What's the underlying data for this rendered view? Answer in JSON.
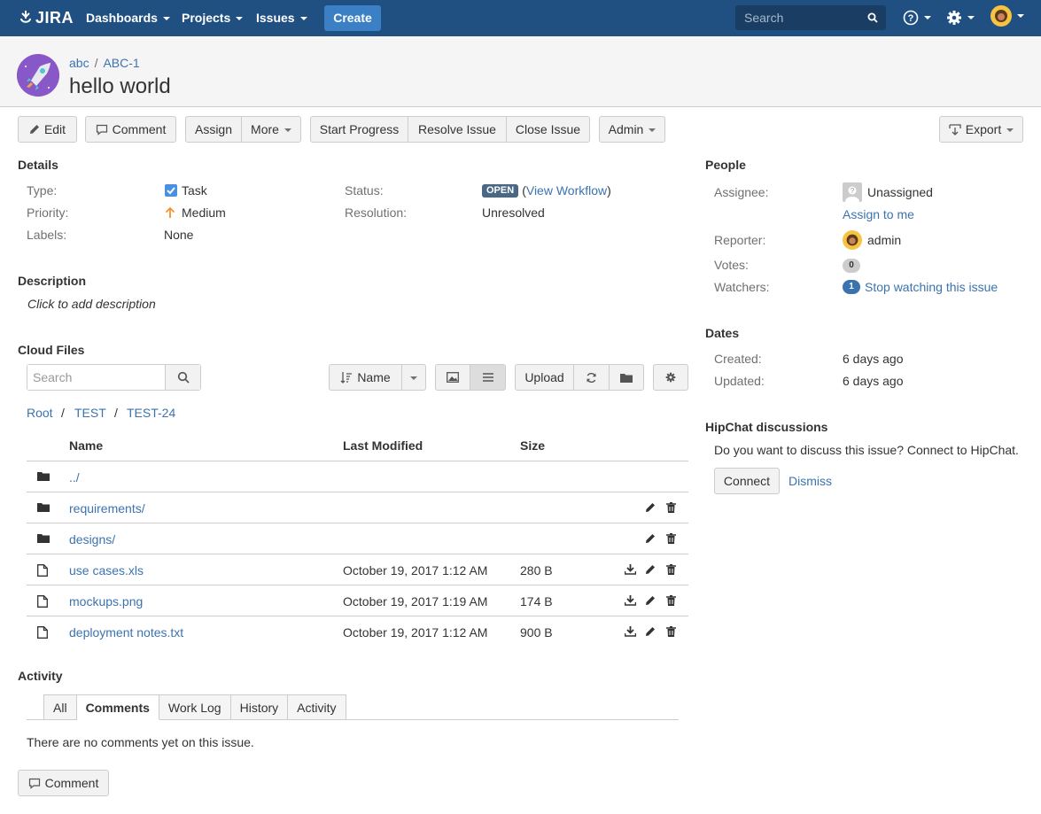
{
  "nav": {
    "logo": "JIRA",
    "dashboards": "Dashboards",
    "projects": "Projects",
    "issues": "Issues",
    "create": "Create",
    "search_placeholder": "Search"
  },
  "header": {
    "project": "abc",
    "issue_key": "ABC-1",
    "title": "hello world"
  },
  "toolbar": {
    "edit": "Edit",
    "comment": "Comment",
    "assign": "Assign",
    "more": "More",
    "start_progress": "Start Progress",
    "resolve": "Resolve Issue",
    "close": "Close Issue",
    "admin": "Admin",
    "export": "Export"
  },
  "details": {
    "heading": "Details",
    "type_label": "Type:",
    "type_value": "Task",
    "priority_label": "Priority:",
    "priority_value": "Medium",
    "labels_label": "Labels:",
    "labels_value": "None",
    "status_label": "Status:",
    "status_value": "OPEN",
    "view_workflow": "View Workflow",
    "resolution_label": "Resolution:",
    "resolution_value": "Unresolved"
  },
  "description": {
    "heading": "Description",
    "placeholder": "Click to add description"
  },
  "cloud_files": {
    "heading": "Cloud Files",
    "search_placeholder": "Search",
    "sort_label": "Name",
    "upload": "Upload",
    "breadcrumb": [
      "Root",
      "TEST",
      "TEST-24"
    ],
    "columns": {
      "name": "Name",
      "modified": "Last Modified",
      "size": "Size"
    },
    "rows": [
      {
        "type": "folder",
        "name": "../",
        "modified": "",
        "size": ""
      },
      {
        "type": "folder",
        "name": "requirements/",
        "modified": "",
        "size": ""
      },
      {
        "type": "folder",
        "name": "designs/",
        "modified": "",
        "size": ""
      },
      {
        "type": "file",
        "name": "use cases.xls",
        "modified": "October 19, 2017 1:12 AM",
        "size": "280 B"
      },
      {
        "type": "file",
        "name": "mockups.png",
        "modified": "October 19, 2017 1:19 AM",
        "size": "174 B"
      },
      {
        "type": "file",
        "name": "deployment notes.txt",
        "modified": "October 19, 2017 1:12 AM",
        "size": "900 B"
      }
    ]
  },
  "activity": {
    "heading": "Activity",
    "tabs": [
      "All",
      "Comments",
      "Work Log",
      "History",
      "Activity"
    ],
    "active_tab": "Comments",
    "empty_text": "There are no comments yet on this issue.",
    "comment_button": "Comment"
  },
  "people": {
    "heading": "People",
    "assignee_label": "Assignee:",
    "assignee_value": "Unassigned",
    "assign_to_me": "Assign to me",
    "reporter_label": "Reporter:",
    "reporter_value": "admin",
    "votes_label": "Votes:",
    "votes_count": "0",
    "watchers_label": "Watchers:",
    "watchers_count": "1",
    "stop_watching": "Stop watching this issue"
  },
  "dates": {
    "heading": "Dates",
    "created_label": "Created:",
    "created_value": "6 days ago",
    "updated_label": "Updated:",
    "updated_value": "6 days ago"
  },
  "hipchat": {
    "heading": "HipChat discussions",
    "text": "Do you want to discuss this issue? Connect to HipChat.",
    "connect": "Connect",
    "dismiss": "Dismiss"
  },
  "colors": {
    "nav_bg": "#205081",
    "link": "#3b73af",
    "status_lozenge": "#4a6785",
    "create_button": "#3b7fc4"
  }
}
